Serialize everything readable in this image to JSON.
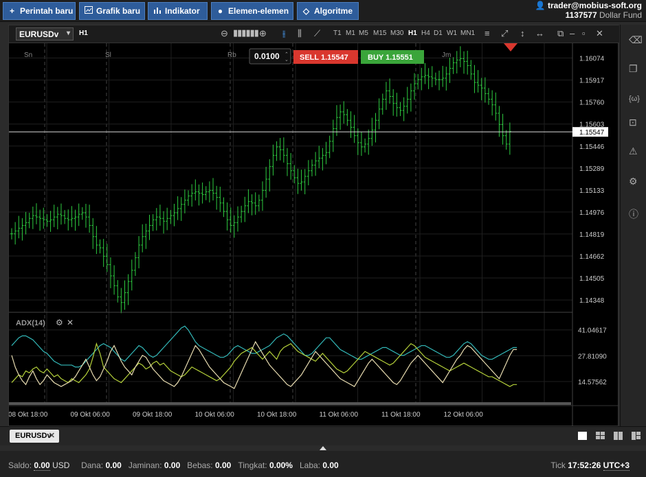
{
  "toolbar": {
    "new_order": "Perintah baru",
    "new_chart": "Grafik baru",
    "indicator": "Indikator",
    "elements": "Elemen-elemen",
    "algorithm": "Algoritme"
  },
  "account": {
    "user": "trader@mobius-soft.org",
    "number": "1137577",
    "fund": "Dollar Fund"
  },
  "chart": {
    "symbol": "EURUSDv",
    "period": "H1",
    "timeframes": [
      "T1",
      "M1",
      "M5",
      "M15",
      "M30",
      "H1",
      "H4",
      "D1",
      "W1",
      "MN1"
    ],
    "active_timeframe": "H1",
    "lot": "0.0100",
    "sell_label": "SELL",
    "sell_price": "1.15547",
    "buy_label": "BUY",
    "buy_price": "1.15551",
    "current_price": "1.15547",
    "day_labels": [
      "Sn",
      "Sl",
      "Rb",
      "Jm"
    ],
    "price_ticks": [
      "1.16074",
      "1.15917",
      "1.15760",
      "1.15603",
      "1.15446",
      "1.15289",
      "1.15133",
      "1.14976",
      "1.14819",
      "1.14662",
      "1.14505",
      "1.14348"
    ],
    "indicator_name": "ADX(14)",
    "indicator_ticks": [
      "41.04617",
      "27.81090",
      "14.57562"
    ],
    "time_labels": [
      "08 Okt 18:00",
      "09 Okt 06:00",
      "09 Okt 18:00",
      "10 Okt 06:00",
      "10 Okt 18:00",
      "11 Okt 06:00",
      "11 Okt 18:00",
      "12 Okt 06:00"
    ],
    "colors": {
      "bull": "#2ecc40",
      "sell": "#d9372e",
      "buy": "#3aa53a",
      "adx": "#e8dcb0",
      "plus_di": "#33b9b9",
      "minus_di": "#b5d13a"
    }
  },
  "chart_data": {
    "type": "line",
    "ylim": [
      1.1428,
      1.1615
    ],
    "closes": [
      1.1482,
      1.1484,
      1.1486,
      1.1488,
      1.149,
      1.1493,
      1.1495,
      1.1494,
      1.1493,
      1.1492,
      1.1491,
      1.1492,
      1.1494,
      1.1496,
      1.1495,
      1.1493,
      1.1492,
      1.1493,
      1.1494,
      1.1496,
      1.1497,
      1.1494,
      1.1488,
      1.148,
      1.1474,
      1.1472,
      1.1466,
      1.146,
      1.1452,
      1.1445,
      1.1437,
      1.1433,
      1.144,
      1.1448,
      1.1456,
      1.1465,
      1.1474,
      1.148,
      1.1484,
      1.1488,
      1.1492,
      1.1494,
      1.1493,
      1.1491,
      1.1493,
      1.1495,
      1.1497,
      1.15,
      1.1503,
      1.1506,
      1.1509,
      1.1511,
      1.1512,
      1.1511,
      1.151,
      1.1512,
      1.1513,
      1.1511,
      1.1508,
      1.1504,
      1.1498,
      1.1492,
      1.1488,
      1.149,
      1.1494,
      1.1498,
      1.1502,
      1.1505,
      1.1504,
      1.1502,
      1.1506,
      1.1513,
      1.1521,
      1.153,
      1.1538,
      1.1544,
      1.1542,
      1.1538,
      1.1532,
      1.1527,
      1.1522,
      1.1518,
      1.1519,
      1.1523,
      1.1527,
      1.1531,
      1.1534,
      1.1536,
      1.1538,
      1.154,
      1.1548,
      1.1557,
      1.1565,
      1.1569,
      1.1567,
      1.1563,
      1.1558,
      1.1552,
      1.1547,
      1.1544,
      1.1546,
      1.155,
      1.1556,
      1.1563,
      1.1571,
      1.1578,
      1.1584,
      1.158,
      1.1575,
      1.1572,
      1.157,
      1.1573,
      1.1578,
      1.1584,
      1.1589,
      1.1592,
      1.1594,
      1.1595,
      1.1594,
      1.1593,
      1.1592,
      1.1592,
      1.1593,
      1.1596,
      1.16,
      1.1604,
      1.1606,
      1.1607,
      1.1605,
      1.1602,
      1.1596,
      1.159,
      1.1588,
      1.1586,
      1.1582,
      1.1578,
      1.1574,
      1.1568,
      1.156,
      1.1552,
      1.1546,
      1.1555
    ],
    "adx": [
      28,
      22,
      18,
      15,
      13,
      17,
      20,
      16,
      13,
      15,
      18,
      16,
      14,
      13,
      12,
      13,
      14,
      15,
      17,
      20,
      23,
      26,
      22,
      18,
      15,
      17,
      21,
      25,
      30,
      33,
      29,
      25,
      22,
      20,
      18,
      22,
      25,
      28,
      27,
      24,
      21,
      19,
      17,
      15,
      14,
      13,
      12,
      14,
      17,
      21,
      25,
      29,
      33,
      31,
      28,
      25,
      22,
      20,
      18,
      16,
      14,
      13,
      12,
      11,
      15,
      19,
      23,
      27,
      31,
      35,
      32,
      29,
      26,
      23,
      21,
      19,
      17,
      15,
      13,
      12,
      14,
      16,
      18,
      21,
      24,
      27,
      30,
      28,
      26,
      24,
      22,
      20,
      18,
      16,
      15,
      14,
      13,
      12,
      15,
      18,
      21,
      24,
      26,
      24,
      22,
      20,
      18,
      16,
      14,
      13,
      15,
      18,
      21,
      24,
      26,
      28,
      26,
      24,
      22,
      20,
      18,
      16,
      14,
      17,
      20,
      23,
      26,
      28,
      31,
      33,
      32,
      30,
      28,
      26,
      24,
      22,
      20,
      18,
      16,
      20,
      24,
      28,
      31,
      31
    ],
    "plus_di": [
      33,
      35,
      37,
      38,
      38,
      37,
      36,
      34,
      32,
      30,
      29,
      27,
      25,
      24,
      23,
      23,
      23,
      23,
      22,
      22,
      23,
      25,
      27,
      29,
      31,
      33,
      34,
      33,
      32,
      30,
      28,
      26,
      25,
      27,
      29,
      31,
      33,
      32,
      30,
      28,
      27,
      28,
      30,
      32,
      34,
      36,
      38,
      40,
      42,
      43,
      41,
      38,
      35,
      33,
      32,
      31,
      30,
      29,
      28,
      27,
      27,
      28,
      30,
      32,
      33,
      32,
      31,
      30,
      29,
      29,
      30,
      31,
      32,
      33,
      35,
      37,
      38,
      39,
      38,
      36,
      34,
      32,
      30,
      28,
      28,
      29,
      31,
      33,
      35,
      37,
      37,
      35,
      33,
      31,
      30,
      29,
      28,
      27,
      26,
      26,
      27,
      28,
      29,
      30,
      31,
      32,
      32,
      31,
      30,
      29,
      28,
      28,
      29,
      30,
      31,
      32,
      33,
      33,
      32,
      31,
      30,
      29,
      28,
      27,
      27,
      28,
      30,
      32,
      34,
      35,
      34,
      32,
      30,
      28,
      27,
      26,
      26,
      27,
      28,
      29,
      30,
      31,
      32,
      32
    ],
    "minus_di": [
      14,
      16,
      18,
      17,
      20,
      19,
      21,
      22,
      20,
      19,
      21,
      19,
      17,
      18,
      16,
      15,
      14,
      16,
      15,
      14,
      16,
      18,
      21,
      27,
      34,
      29,
      22,
      20,
      18,
      16,
      15,
      14,
      16,
      18,
      20,
      22,
      24,
      23,
      21,
      22,
      24,
      25,
      23,
      24,
      22,
      20,
      19,
      18,
      17,
      18,
      20,
      22,
      21,
      20,
      19,
      18,
      17,
      16,
      15,
      16,
      18,
      20,
      22,
      25,
      27,
      29,
      30,
      31,
      32,
      30,
      28,
      26,
      28,
      30,
      28,
      26,
      30,
      32,
      33,
      34,
      32,
      30,
      29,
      28,
      27,
      26,
      25,
      27,
      29,
      27,
      25,
      23,
      21,
      20,
      19,
      20,
      22,
      24,
      26,
      28,
      30,
      29,
      28,
      27,
      26,
      25,
      24,
      23,
      24,
      26,
      28,
      30,
      32,
      34,
      33,
      31,
      29,
      27,
      26,
      25,
      24,
      23,
      22,
      21,
      20,
      21,
      22,
      23,
      24,
      23,
      22,
      21,
      20,
      19,
      18,
      17,
      17,
      16,
      15,
      14,
      13,
      12,
      13,
      13
    ]
  },
  "tabs": [
    {
      "label": "EURUSDv"
    }
  ],
  "status": {
    "balance_label": "Saldo:",
    "balance": "0.00",
    "currency": "USD",
    "funds_label": "Dana:",
    "funds": "0.00",
    "margin_label": "Jaminan:",
    "margin": "0.00",
    "free_label": "Bebas:",
    "free": "0.00",
    "level_label": "Tingkat:",
    "level": "0.00%",
    "profit_label": "Laba:",
    "profit": "0.00",
    "tick_label": "Tick",
    "time": "17:52:26",
    "tz": "UTC+3"
  }
}
